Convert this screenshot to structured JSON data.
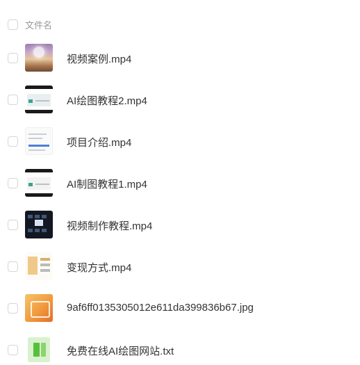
{
  "header": {
    "column_label": "文件名"
  },
  "files": [
    {
      "name": "视频案例.mp4",
      "thumb": "photo-thumbnail-icon"
    },
    {
      "name": "AI绘图教程2.mp4",
      "thumb": "video-thumbnail-icon"
    },
    {
      "name": "项目介绍.mp4",
      "thumb": "video-thumbnail-icon"
    },
    {
      "name": "AI制图教程1.mp4",
      "thumb": "video-thumbnail-icon"
    },
    {
      "name": "视频制作教程.mp4",
      "thumb": "video-thumbnail-icon"
    },
    {
      "name": "变现方式.mp4",
      "thumb": "video-thumbnail-icon"
    },
    {
      "name": "9af6ff0135305012e611da399836b67.jpg",
      "thumb": "image-thumbnail-icon"
    },
    {
      "name": "免费在线AI绘图网站.txt",
      "thumb": "txt-file-icon"
    }
  ]
}
